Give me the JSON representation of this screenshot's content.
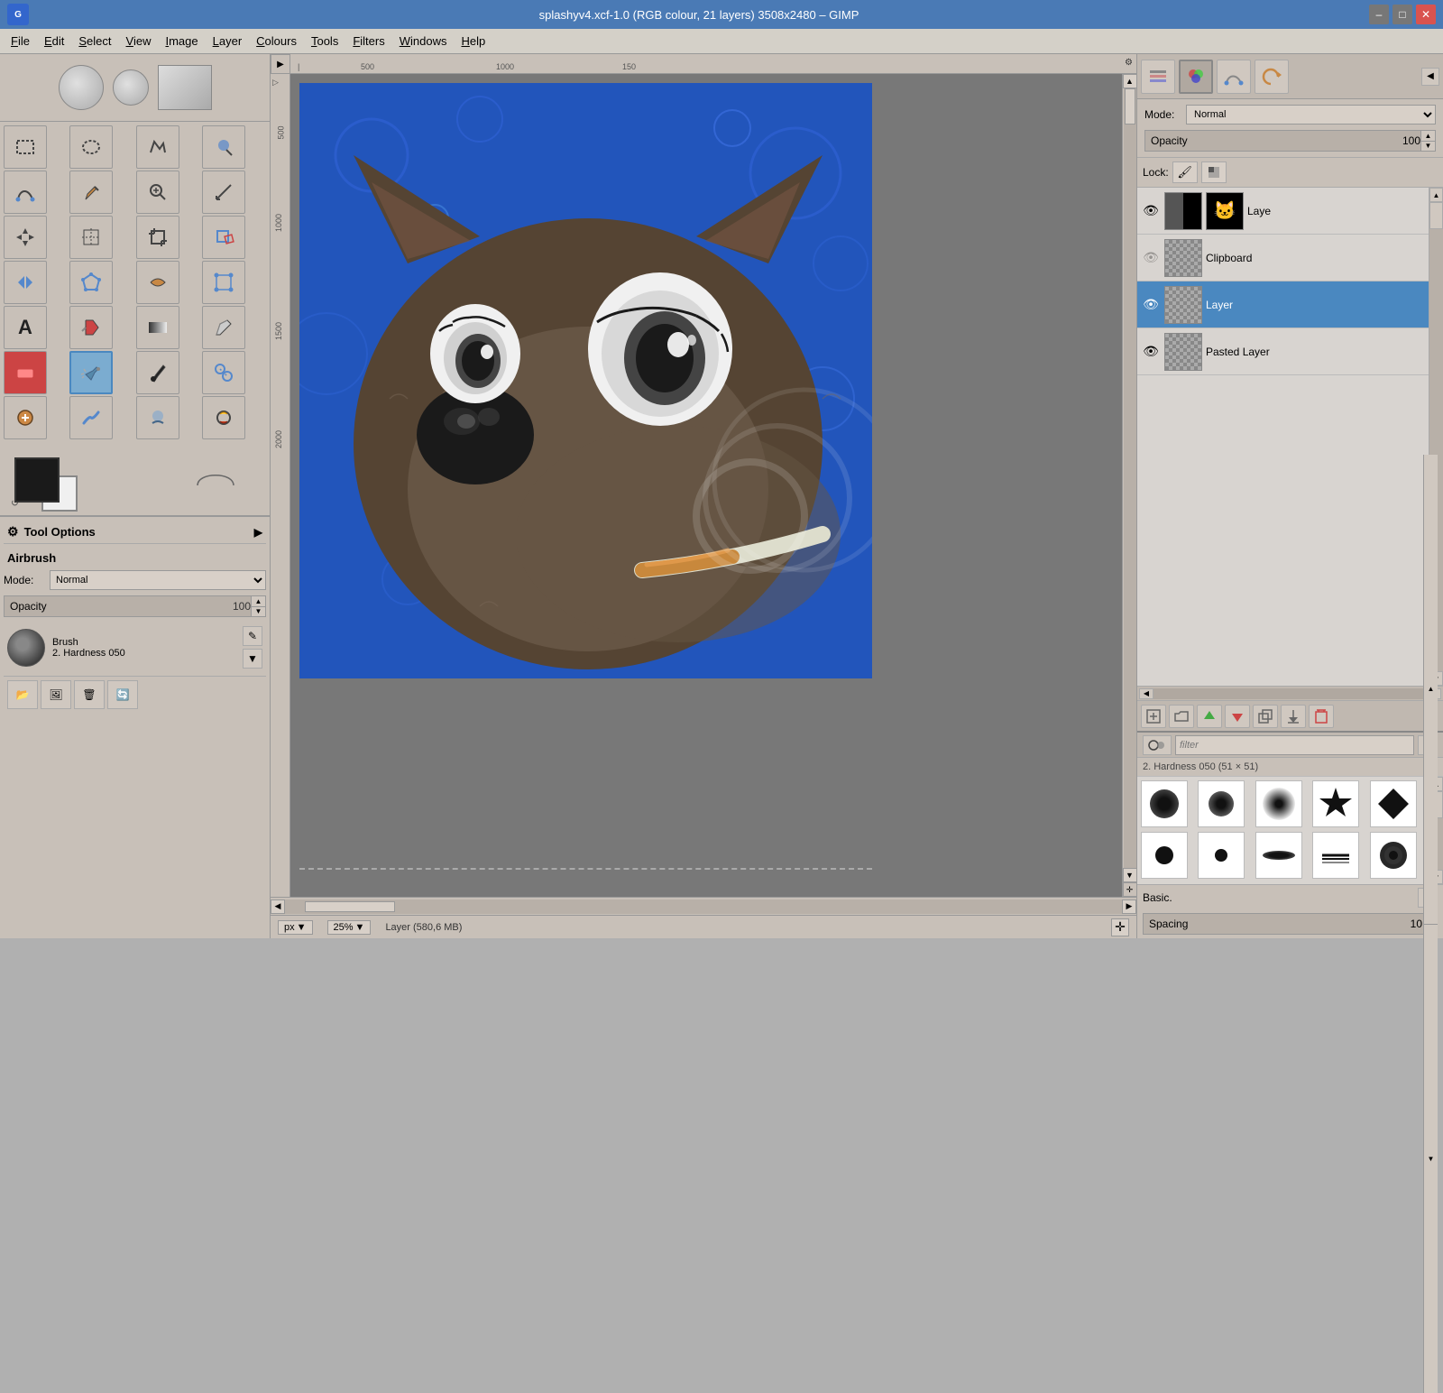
{
  "titlebar": {
    "title": "splashyv4.xcf-1.0 (RGB colour, 21 layers) 3508x2480 – GIMP"
  },
  "menubar": {
    "items": [
      "File",
      "Edit",
      "Select",
      "View",
      "Image",
      "Layer",
      "Colours",
      "Tools",
      "Filters",
      "Windows",
      "Help"
    ]
  },
  "tools": [
    {
      "name": "rect-select",
      "icon": "⬜",
      "active": false
    },
    {
      "name": "ellipse-select",
      "icon": "⬭",
      "active": false
    },
    {
      "name": "free-select",
      "icon": "🗾",
      "active": false
    },
    {
      "name": "fuzzy-select",
      "icon": "🪄",
      "active": false
    },
    {
      "name": "paths",
      "icon": "✒",
      "active": false
    },
    {
      "name": "color-pick",
      "icon": "🎨",
      "active": false
    },
    {
      "name": "zoom",
      "icon": "🔍",
      "active": false
    },
    {
      "name": "measure",
      "icon": "📐",
      "active": false
    },
    {
      "name": "move",
      "icon": "✛",
      "active": false
    },
    {
      "name": "align",
      "icon": "⊞",
      "active": false
    },
    {
      "name": "crop",
      "icon": "⊡",
      "active": false
    },
    {
      "name": "transform",
      "icon": "🔄",
      "active": false
    },
    {
      "name": "flip",
      "icon": "⇄",
      "active": false
    },
    {
      "name": "cage-transform",
      "icon": "⊛",
      "active": false
    },
    {
      "name": "text",
      "icon": "A",
      "active": false
    },
    {
      "name": "bucket-fill",
      "icon": "🪣",
      "active": false
    },
    {
      "name": "gradient",
      "icon": "▦",
      "active": false
    },
    {
      "name": "pencil",
      "icon": "✎",
      "active": false
    },
    {
      "name": "paintbrush",
      "icon": "🖌",
      "active": false
    },
    {
      "name": "eraser",
      "icon": "▫",
      "active": false
    },
    {
      "name": "airbrush",
      "icon": "💨",
      "active": true
    },
    {
      "name": "ink",
      "icon": "🖊",
      "active": false
    },
    {
      "name": "clone",
      "icon": "⎘",
      "active": false
    },
    {
      "name": "heal",
      "icon": "✚",
      "active": false
    },
    {
      "name": "smudge",
      "icon": "👆",
      "active": false
    },
    {
      "name": "blur",
      "icon": "💧",
      "active": false
    },
    {
      "name": "dodge-burn",
      "icon": "☀",
      "active": false
    },
    {
      "name": "desaturate",
      "icon": "◎",
      "active": false
    }
  ],
  "tool_options": {
    "title": "Tool Options",
    "tool_name": "Airbrush",
    "mode_label": "Mode:",
    "mode_value": "Normal",
    "opacity_label": "Opacity",
    "opacity_value": "100,0",
    "brush_label": "Brush",
    "brush_name": "2. Hardness 050"
  },
  "layers": {
    "mode_label": "Mode:",
    "mode_value": "Normal",
    "opacity_label": "Opacity",
    "opacity_value": "100,0",
    "lock_label": "Lock:",
    "items": [
      {
        "name": "Laye",
        "active": false,
        "visible": true,
        "type": "masked"
      },
      {
        "name": "Clipboard",
        "active": false,
        "visible": false,
        "type": "clipboard"
      },
      {
        "name": "Layer",
        "active": true,
        "visible": true,
        "type": "checker"
      },
      {
        "name": "Pasted Layer",
        "active": false,
        "visible": true,
        "type": "checker"
      }
    ]
  },
  "brushes": {
    "filter_placeholder": "filter",
    "current_brush": "2. Hardness 050 (51 × 51)",
    "preset_label": "Basic.",
    "spacing_label": "Spacing",
    "spacing_value": "10,0"
  },
  "statusbar": {
    "unit": "px",
    "zoom": "25%",
    "layer_info": "Layer (580,6 MB)"
  }
}
